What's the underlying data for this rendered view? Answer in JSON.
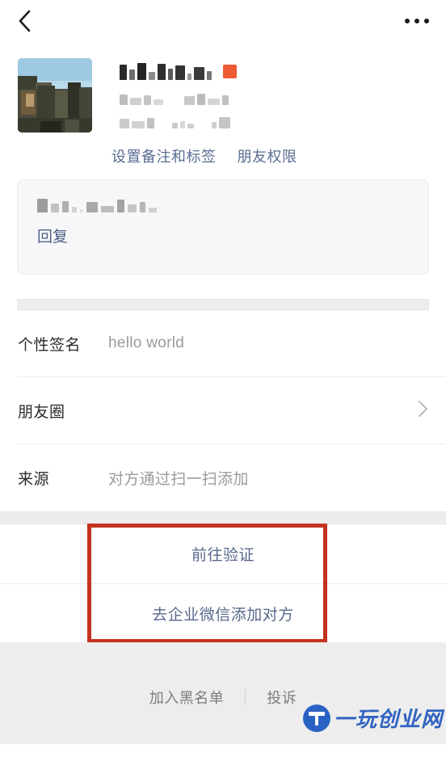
{
  "navbar": {
    "back_icon": "chevron-left-icon",
    "more_icon": "more-dots-icon"
  },
  "profile": {
    "avatar_alt": "landscape-photo-avatar",
    "name_redacted": true,
    "badge_color": "#ef5b34",
    "links": [
      {
        "label": "设置备注和标签"
      },
      {
        "label": "朋友权限"
      }
    ]
  },
  "reply_card": {
    "content_redacted": true,
    "reply_label": "回复"
  },
  "info": {
    "rows": [
      {
        "label": "个性签名",
        "value": "hello world",
        "chevron": false
      },
      {
        "label": "朋友圈",
        "value": "",
        "chevron": true
      },
      {
        "label": "来源",
        "value": "对方通过扫一扫添加",
        "chevron": false
      }
    ]
  },
  "actions": {
    "items": [
      {
        "label": "前往验证"
      },
      {
        "label": "去企业微信添加对方"
      }
    ],
    "highlight_color": "#c4331f"
  },
  "footer": {
    "links": [
      {
        "label": "加入黑名单"
      },
      {
        "label": "投诉"
      }
    ],
    "watermark": {
      "text": "一玩创业网",
      "icon": "circle-logo-icon",
      "color": "#2f63c0"
    }
  },
  "colors": {
    "link_blue": "#5a6d93",
    "action_blue": "#58678c",
    "page_bg": "#ededed",
    "card_bg": "#f7f7f9"
  }
}
